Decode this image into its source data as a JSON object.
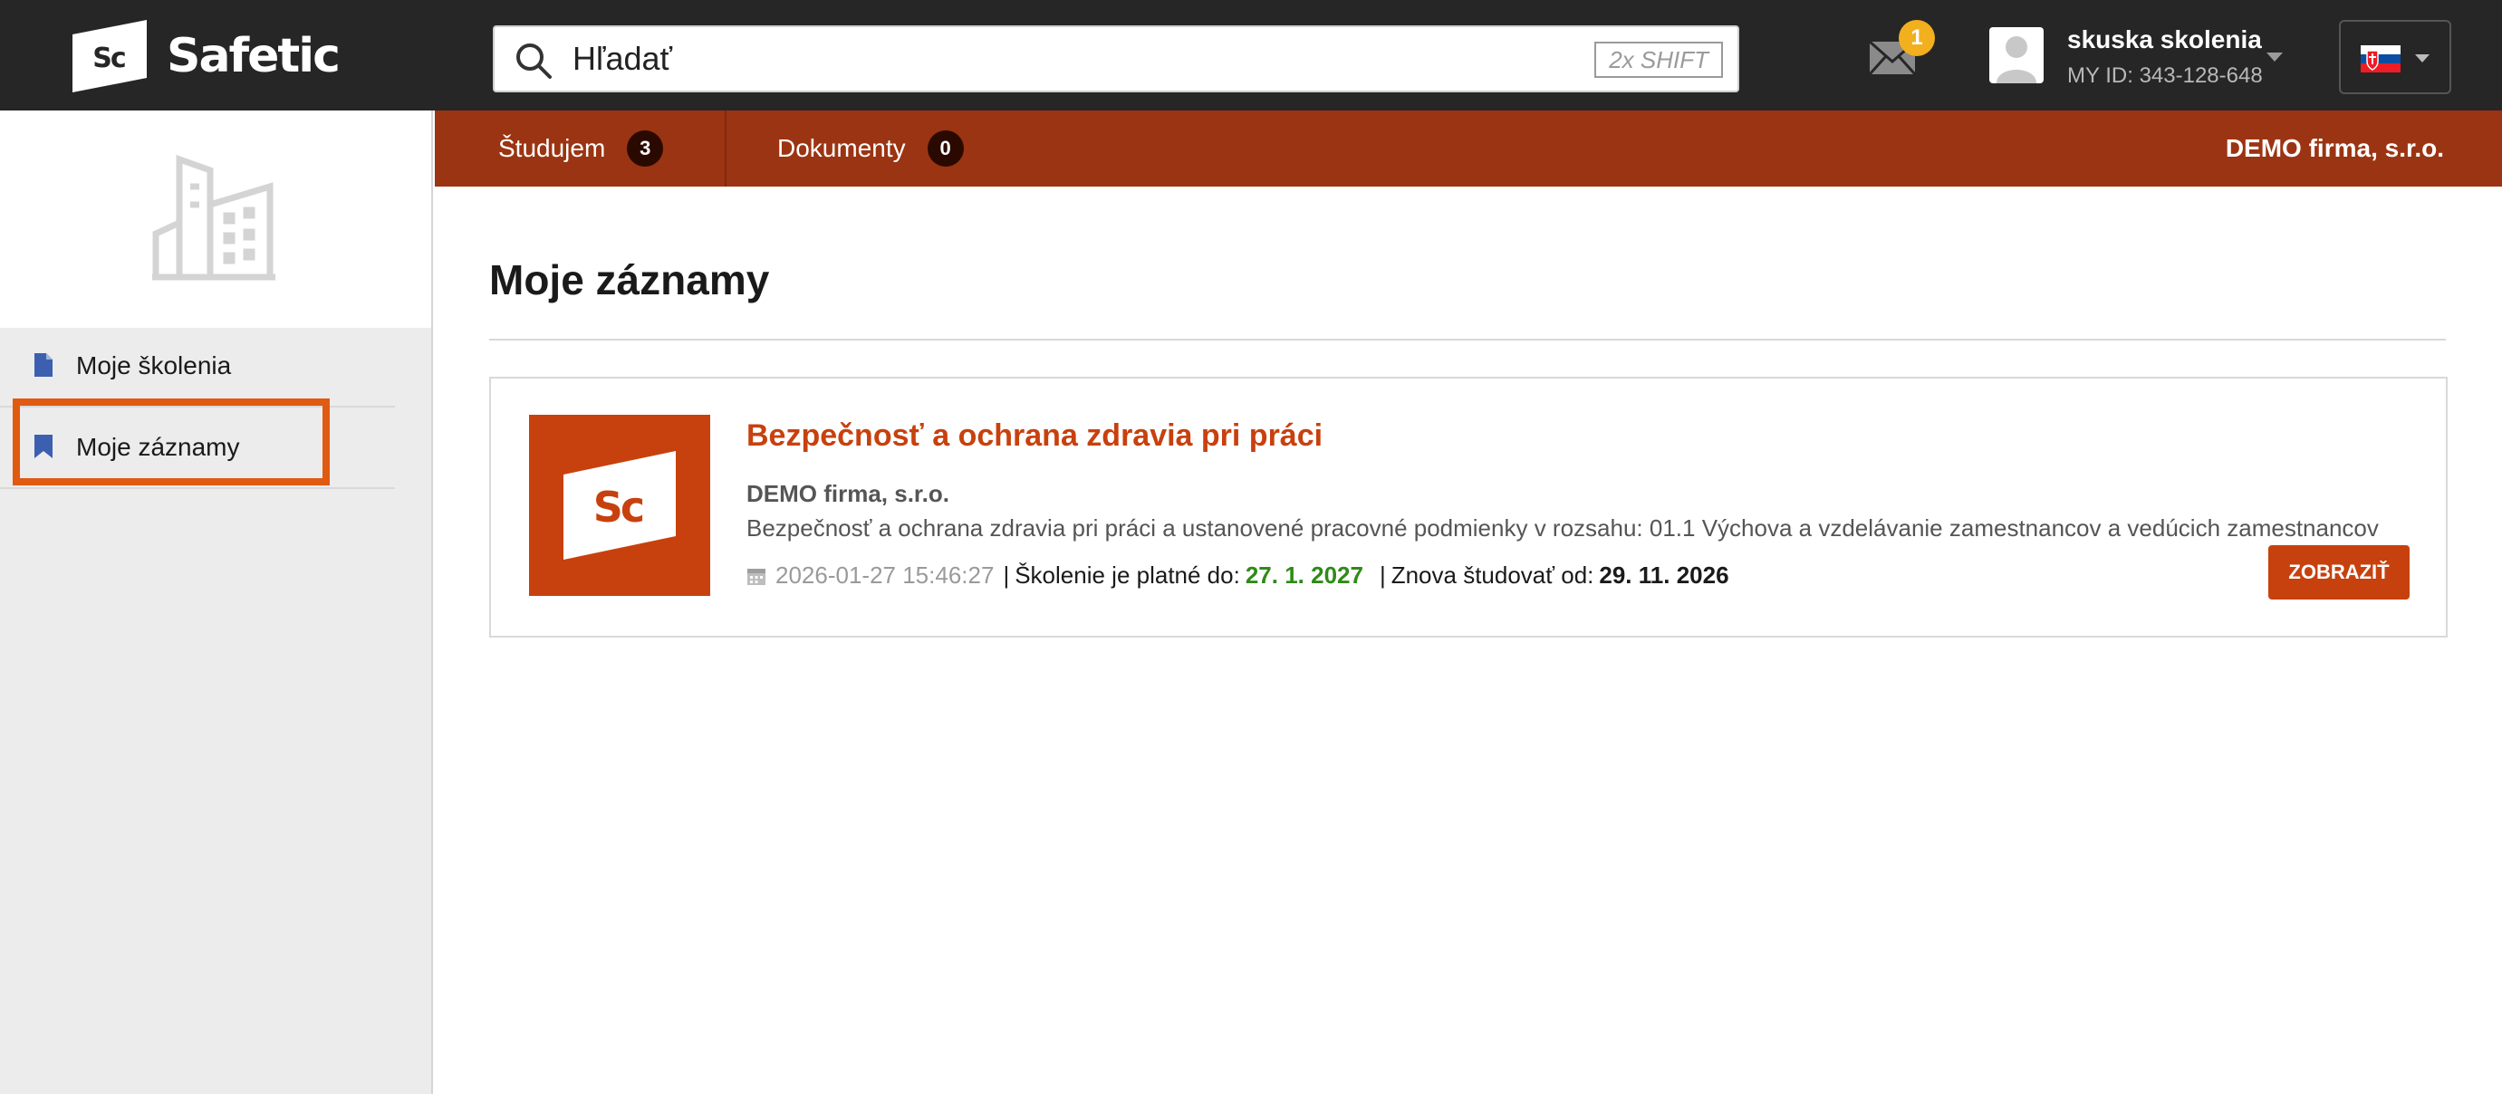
{
  "header": {
    "brand": "Safetic",
    "logo_letters": "Sc",
    "search": {
      "placeholder": "Hľadať",
      "shortcut": "2x SHIFT"
    },
    "messages": {
      "icon": "mail-icon",
      "count": "1"
    },
    "user": {
      "name": "skuska skolenia",
      "id_label": "MY ID: 343-128-648"
    },
    "language": {
      "icon": "flag-slovakia-icon"
    }
  },
  "tabs": [
    {
      "label": "Študujem",
      "count": "3"
    },
    {
      "label": "Dokumenty",
      "count": "0"
    }
  ],
  "company": "DEMO firma, s.r.o.",
  "sidebar": {
    "header_icon": "building-icon",
    "items": [
      {
        "label": "Moje školenia",
        "icon": "document-icon"
      },
      {
        "label": "Moje záznamy",
        "icon": "bookmark-icon"
      }
    ]
  },
  "main": {
    "title": "Moje záznamy",
    "records": [
      {
        "title": "Bezpečnosť a ochrana zdravia pri práci",
        "company": "DEMO firma, s.r.o.",
        "description": "Bezpečnosť a ochrana zdravia pri práci a ustanovené pracovné podmienky v rozsahu: 01.1 Výchova a vzdelávanie zamestnancov a vedúcich zamestnancov",
        "date": "2026-01-27 15:46:27",
        "valid_label": "Školenie je platné do:",
        "valid_until": "27. 1. 2027",
        "restudy_label": "Znova študovať od:",
        "restudy_from": "29. 11. 2026",
        "button": "ZOBRAZIŤ"
      }
    ]
  },
  "colors": {
    "topbar": "#262626",
    "tabbar": "#9b3412",
    "accent": "#c7410e",
    "valid_green": "#2e8b16",
    "highlight": "#e05a12"
  }
}
